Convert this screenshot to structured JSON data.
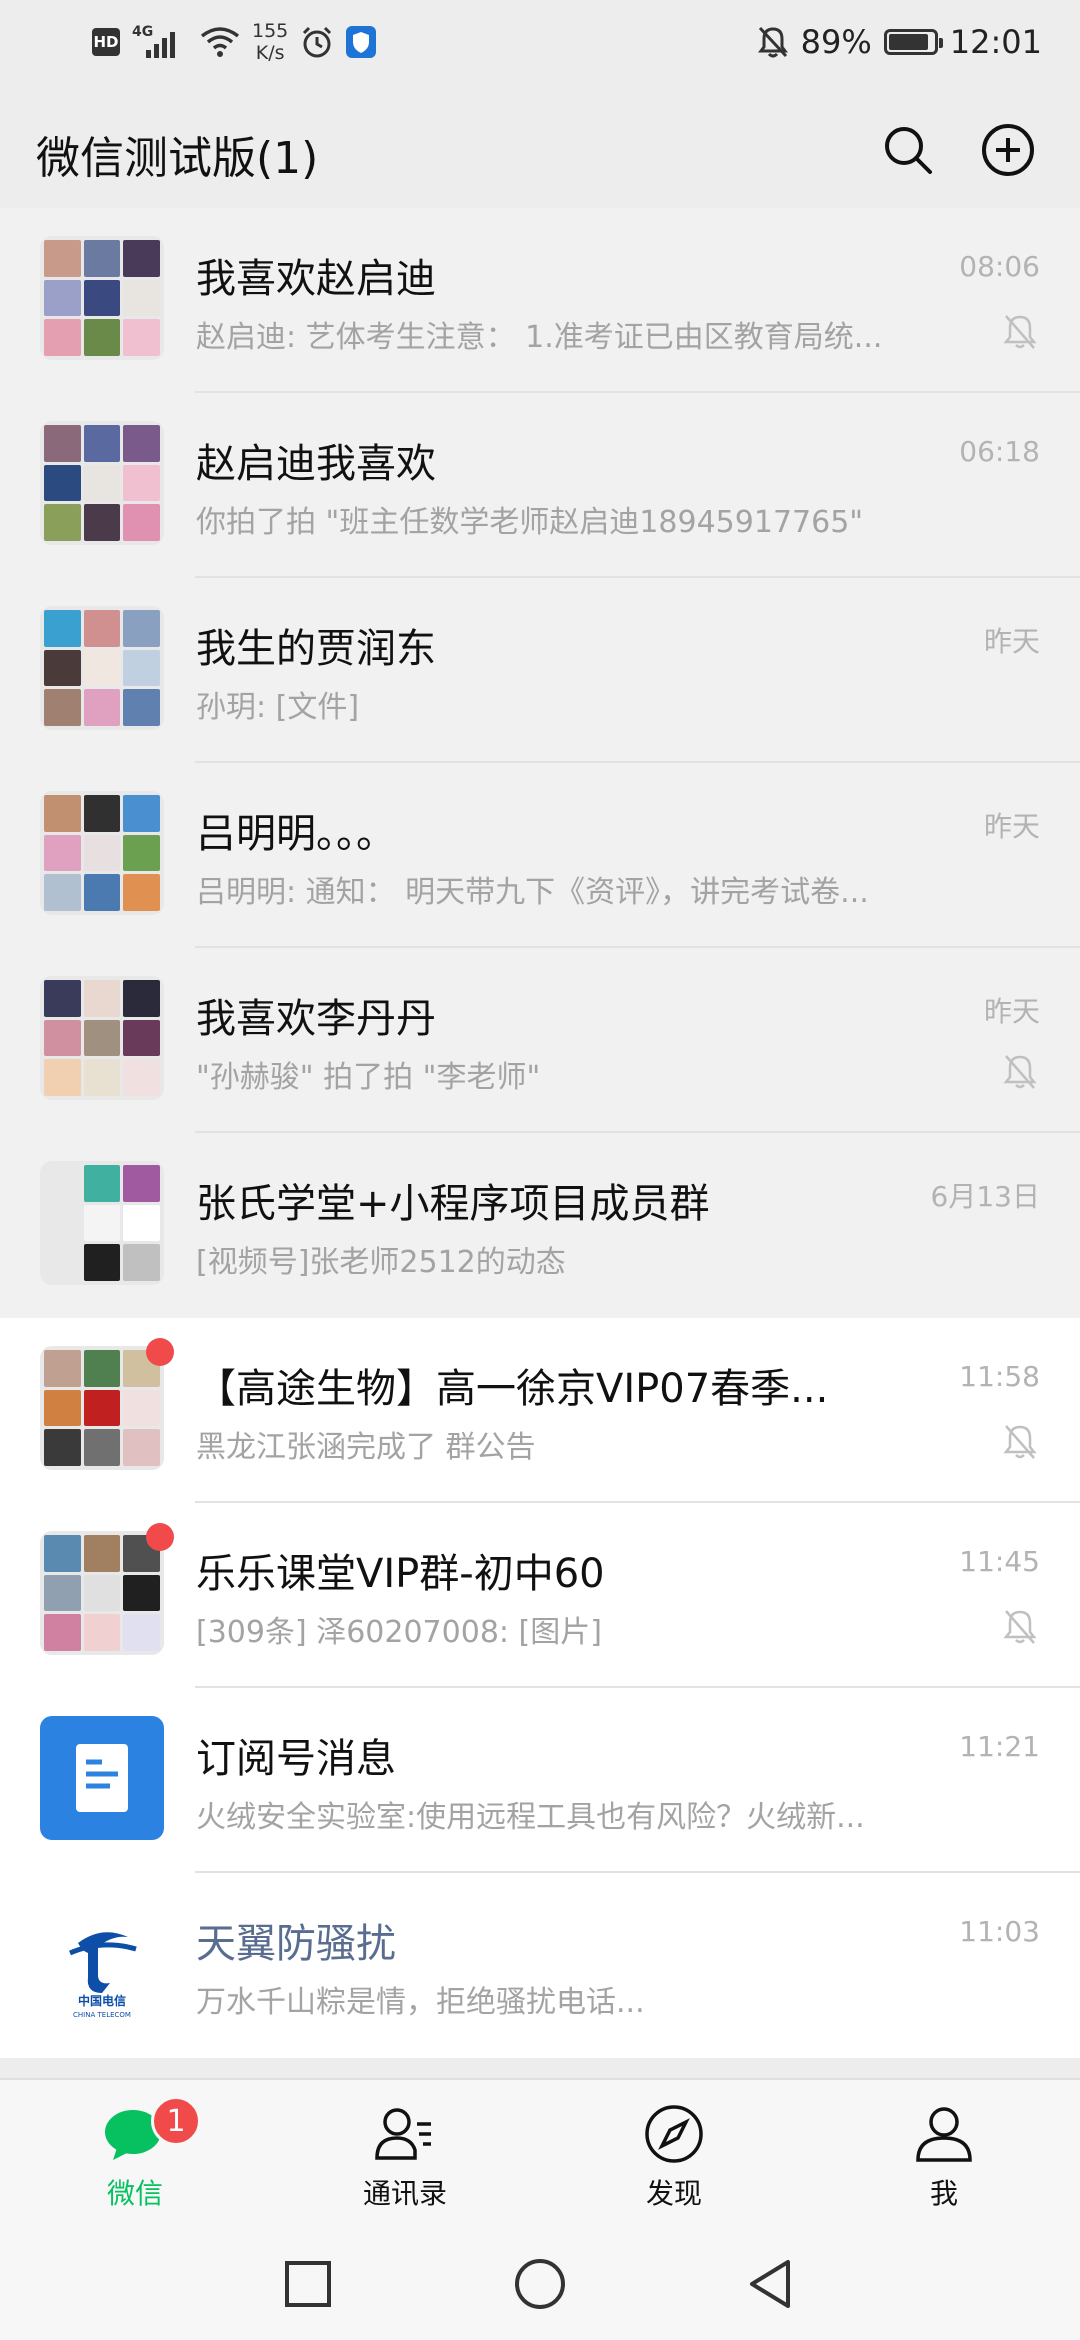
{
  "status_bar": {
    "hd": "HD",
    "network": "4G",
    "speed_value": "155",
    "speed_unit": "K/s",
    "battery": "89%",
    "battery_level": 0.89,
    "time": "12:01",
    "icons": [
      "hd-icon",
      "signal-icon",
      "wifi-icon",
      "alarm-icon",
      "shield-icon",
      "mute-bell-icon",
      "battery-icon"
    ]
  },
  "header": {
    "title": "微信测试版(1)",
    "icons": [
      "search-icon",
      "add-circle-icon"
    ]
  },
  "chats": [
    {
      "name": "我喜欢赵启迪",
      "preview": "赵启迪: 艺体考生注意： 1.准考证已由区教育局统...",
      "time": "08:06",
      "muted": true,
      "pinned": true,
      "unread_dot": false
    },
    {
      "name": "赵启迪我喜欢",
      "preview": "你拍了拍 \"班主任数学老师赵启迪18945917765\"",
      "time": "06:18",
      "muted": false,
      "pinned": true,
      "unread_dot": false
    },
    {
      "name": "我生的贾润东",
      "preview": "孙玥: [文件]",
      "time": "昨天",
      "muted": false,
      "pinned": true,
      "unread_dot": false
    },
    {
      "name": "吕明明。。。",
      "preview": "吕明明: 通知： 明天带九下《资评》，讲完考试卷...",
      "time": "昨天",
      "muted": false,
      "pinned": true,
      "unread_dot": false
    },
    {
      "name": "我喜欢李丹丹",
      "preview": "\"孙赫骏\" 拍了拍 \"李老师\"",
      "time": "昨天",
      "muted": true,
      "pinned": true,
      "unread_dot": false
    },
    {
      "name": "张氏学堂+小程序项目成员群",
      "preview": "[视频号]张老师2512的动态",
      "time": "6月13日",
      "muted": false,
      "pinned": true,
      "unread_dot": false
    },
    {
      "name": "【高途生物】高一徐京VIP07春季...",
      "preview": "黑龙江张涵完成了 群公告",
      "time": "11:58",
      "muted": true,
      "pinned": false,
      "unread_dot": true
    },
    {
      "name": "乐乐课堂VIP群-初中60",
      "preview": "[309条] 泽60207008: [图片]",
      "time": "11:45",
      "muted": true,
      "pinned": false,
      "unread_dot": true
    },
    {
      "name": "订阅号消息",
      "preview": "火绒安全实验室:使用远程工具也有风险？火绒新...",
      "time": "11:21",
      "muted": false,
      "pinned": false,
      "unread_dot": false
    },
    {
      "name": "天翼防骚扰",
      "preview": "万水千山粽是情，拒绝骚扰电话...",
      "time": "11:03",
      "muted": false,
      "pinned": false,
      "unread_dot": false
    }
  ],
  "logo_text": {
    "telecom_cn": "中国电信",
    "telecom_en": "CHINA TELECOM"
  },
  "tabs": [
    {
      "label": "微信",
      "icon": "chat-bubble-icon",
      "active": true,
      "badge": "1"
    },
    {
      "label": "通讯录",
      "icon": "contacts-icon",
      "active": false
    },
    {
      "label": "发现",
      "icon": "compass-icon",
      "active": false
    },
    {
      "label": "我",
      "icon": "person-icon",
      "active": false
    }
  ],
  "nav": [
    "recent-apps-icon",
    "home-icon",
    "back-icon"
  ],
  "colors": {
    "accent": "#07c160",
    "badge": "#f04a4a",
    "subscription_blue": "#2c82e0",
    "telecom_blue": "#0d4fa8"
  }
}
